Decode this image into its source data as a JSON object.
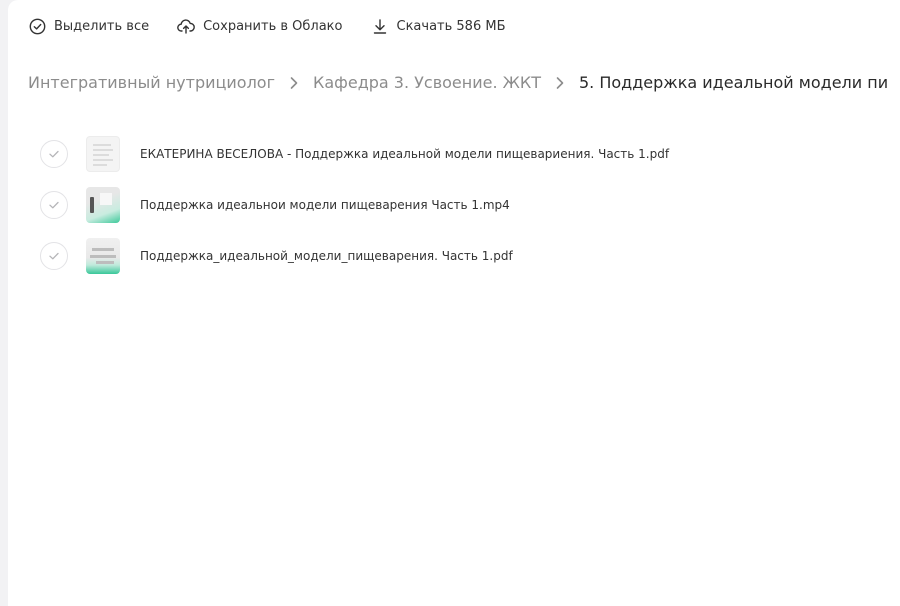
{
  "toolbar": {
    "select_all_label": "Выделить все",
    "save_cloud_label": "Сохранить в Облако",
    "download_label": "Скачать 586 МБ"
  },
  "breadcrumb": {
    "items": [
      "Интегративный нутрициолог",
      "Кафедра 3. Усвоение. ЖКТ"
    ],
    "current": "5. Поддержка идеальной модели пи..."
  },
  "files": [
    {
      "name": "ЕКАТЕРИНА ВЕСЕЛОВА - Поддержка идеальной модели пищевариения. Часть 1.pdf",
      "thumbnail": "document",
      "selected": false
    },
    {
      "name": "Поддержка идеальнои модели пищеварения Часть 1.mp4",
      "thumbnail": "video",
      "selected": false
    },
    {
      "name": "Поддержка_идеальной_модели_пищеварения. Часть 1.pdf",
      "thumbnail": "document",
      "selected": false
    }
  ],
  "colors": {
    "accent_green": "#3ec99a",
    "crumb_muted": "#8c8c8c",
    "text_dark": "#2a2a2a"
  }
}
